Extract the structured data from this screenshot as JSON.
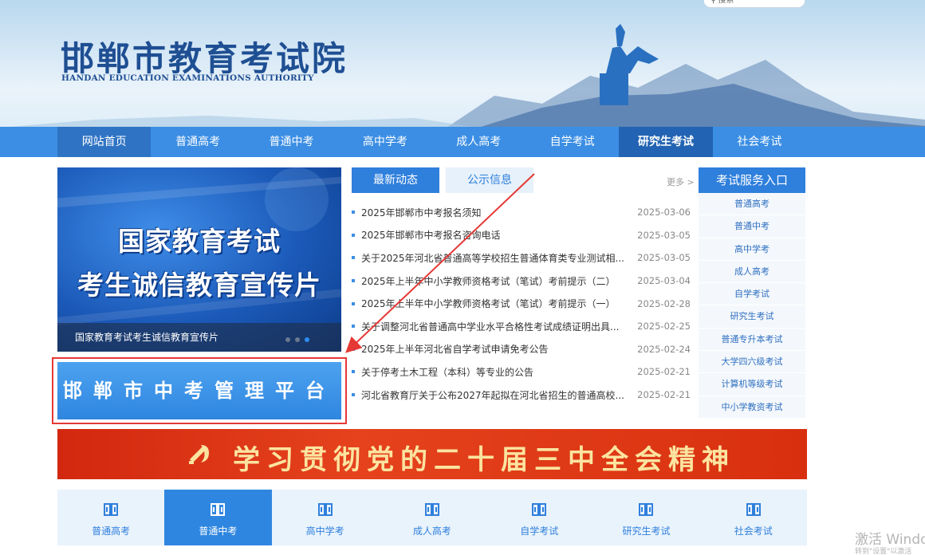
{
  "header": {
    "title_cn": "邯郸市教育考试院",
    "title_en": "HANDAN EDUCATION EXAMINATIONS AUTHORITY",
    "search_label": "搜索",
    "search_icon": "search-icon"
  },
  "nav": {
    "items": [
      "网站首页",
      "普通高考",
      "普通中考",
      "高中学考",
      "成人高考",
      "自学考试",
      "研究生考试",
      "社会考试"
    ]
  },
  "banner": {
    "line1": "国家教育考试",
    "line2": "考生诚信教育宣传片",
    "caption": "国家教育考试考生诚信教育宣传片"
  },
  "platform": {
    "label": "邯郸市中考管理平台"
  },
  "news": {
    "tabs": [
      "最新动态",
      "公示信息"
    ],
    "more": "更多 >",
    "items": [
      {
        "title": "2025年邯郸市中考报名须知",
        "date": "2025-03-06"
      },
      {
        "title": "2025年邯郸市中考报名咨询电话",
        "date": "2025-03-05"
      },
      {
        "title": "关于2025年河北省普通高等学校招生普通体育类专业测试相...",
        "date": "2025-03-05"
      },
      {
        "title": "2025年上半年中小学教师资格考试（笔试）考前提示（二）",
        "date": "2025-03-04"
      },
      {
        "title": "2025年上半年中小学教师资格考试（笔试）考前提示（一）",
        "date": "2025-02-28"
      },
      {
        "title": "关于调整河北省普通高中学业水平合格性考试成绩证明出具...",
        "date": "2025-02-25"
      },
      {
        "title": "2025年上半年河北省自学考试申请免考公告",
        "date": "2025-02-24"
      },
      {
        "title": "关于停考土木工程（本科）等专业的公告",
        "date": "2025-02-21"
      },
      {
        "title": "河北省教育厅关于公布2027年起拟在河北省招生的普通高校...",
        "date": "2025-02-21"
      }
    ]
  },
  "service": {
    "title": "考试服务入口",
    "items": [
      "普通高考",
      "普通中考",
      "高中学考",
      "成人高考",
      "自学考试",
      "研究生考试",
      "普通专升本考试",
      "大学四六级考试",
      "计算机等级考试",
      "中小学教资考试"
    ]
  },
  "red_banner": {
    "text": "学习贯彻党的二十届三中全会精神"
  },
  "quick_links": [
    "普通高考",
    "普通中考",
    "高中学考",
    "成人高考",
    "自学考试",
    "研究生考试",
    "社会考试"
  ],
  "watermark": {
    "line1": "激活 Windo",
    "line2": "转到\"设置\"以激活"
  },
  "colors": {
    "nav_blue": "#3b8ee4",
    "active_blue": "#2264b3",
    "annotation_red": "#e53935",
    "party_red": "#d8300f"
  }
}
